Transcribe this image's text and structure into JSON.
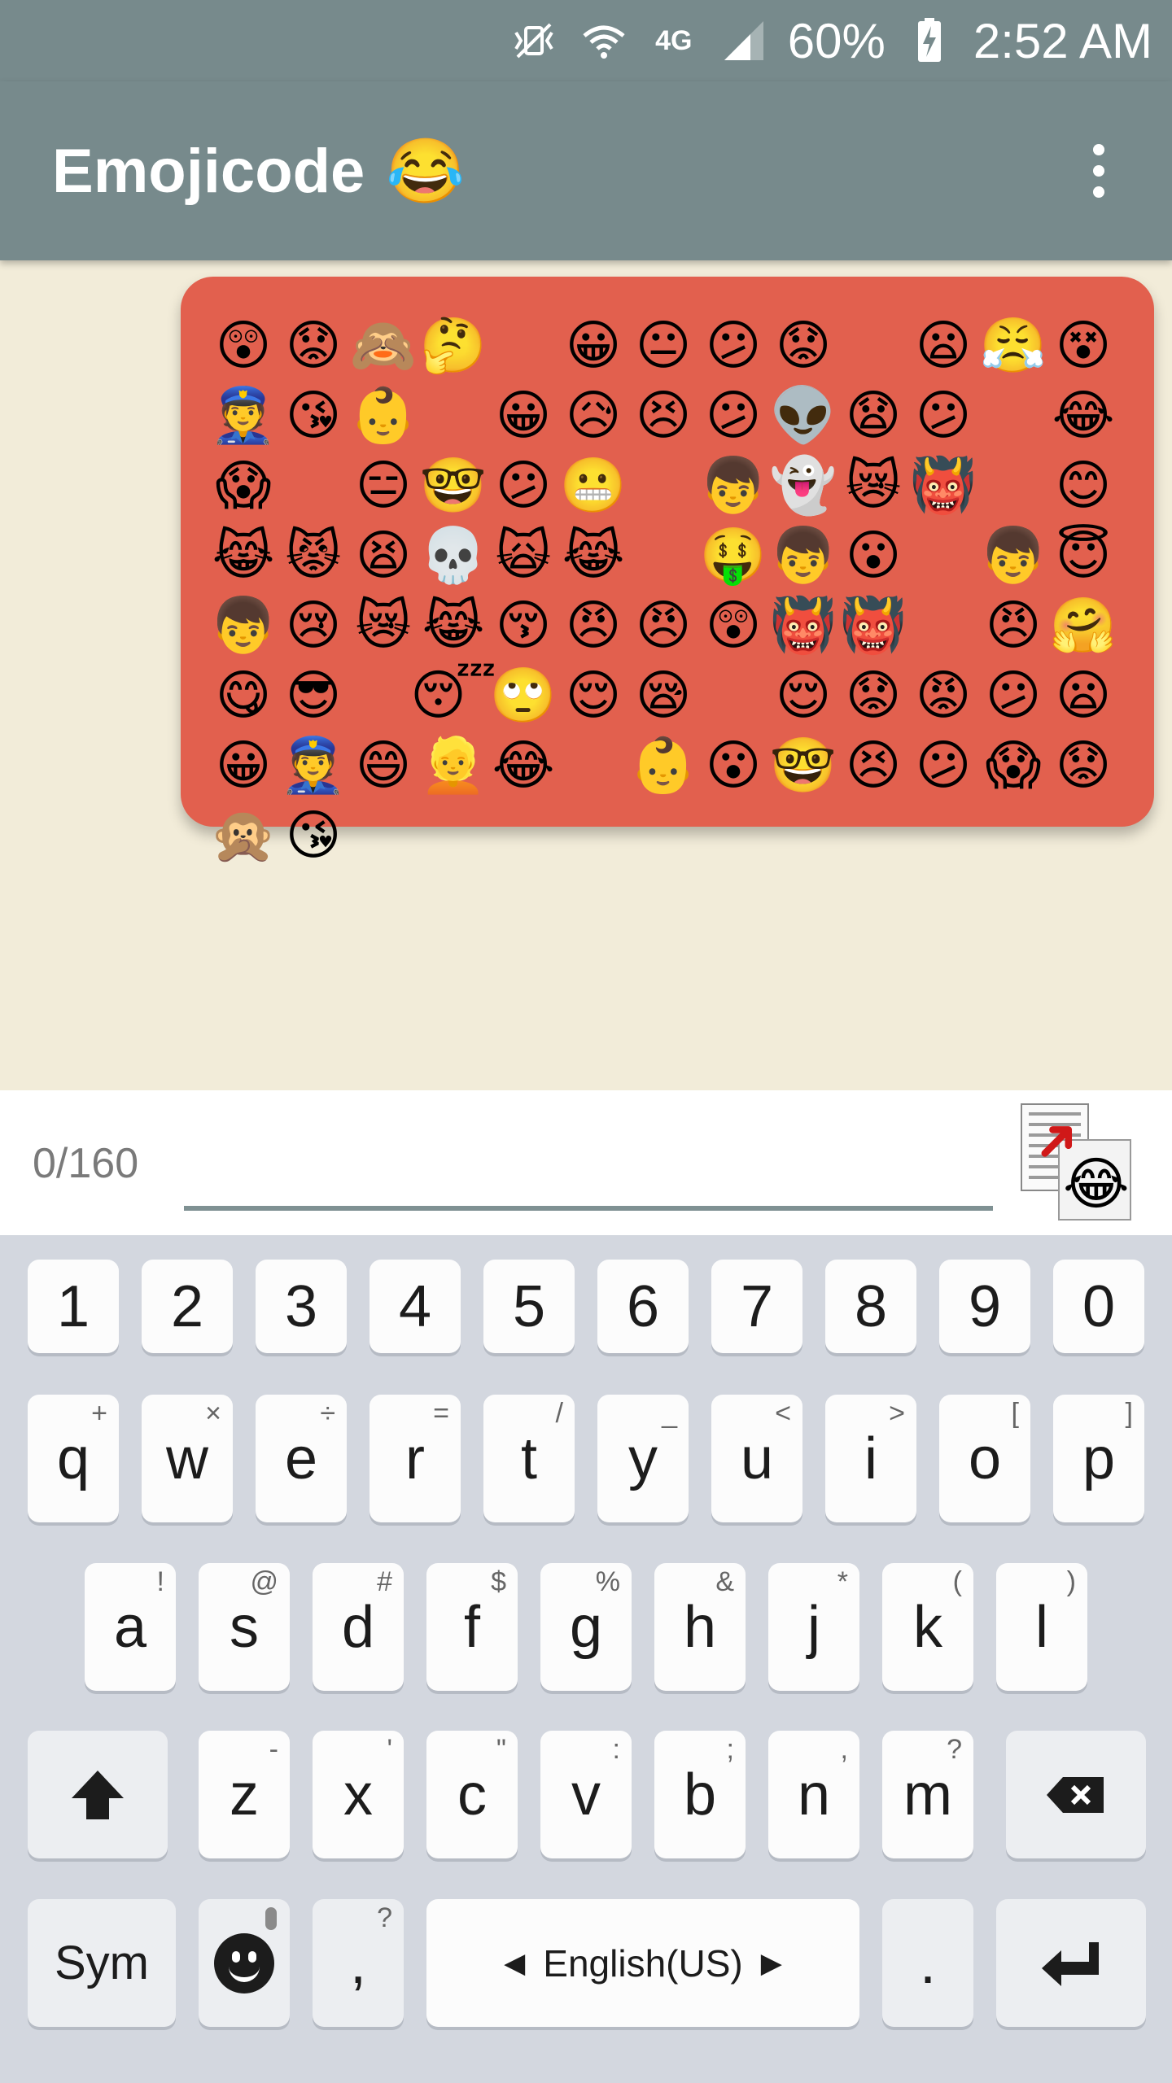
{
  "status": {
    "battery": "60%",
    "time": "2:52 AM",
    "network": "4G"
  },
  "appbar": {
    "title": "Emojicode",
    "title_emoji": "😂",
    "menu_icon": "overflow-menu-icon"
  },
  "message": {
    "bubble_color": "#e2604e",
    "emojis": [
      "😲",
      "😟",
      "🙈",
      "🤔",
      "",
      "😀",
      "😐",
      "😕",
      "😟",
      "",
      "😦",
      "😤",
      "😵",
      "👮",
      "😘",
      "👶",
      "",
      "😀",
      "😥",
      "😣",
      "😕",
      "👽",
      "😧",
      "😕",
      "",
      "😂",
      "😱",
      "",
      "😑",
      "🤓",
      "😕",
      "😬",
      "",
      "👦",
      "👻",
      "😿",
      "👹",
      "",
      "😊",
      "😹",
      "😾",
      "😫",
      "💀",
      "🙀",
      "😹",
      "",
      "🤑",
      "👦",
      "😮",
      "",
      "👦",
      "😇",
      "👦",
      "😢",
      "😿",
      "😹",
      "😚",
      "😠",
      "😠",
      "😲",
      "👹",
      "👹",
      "",
      "😠",
      "🤗",
      "😋",
      "😎",
      "",
      "😴",
      "🙄",
      "😌",
      "😪",
      "",
      "😌",
      "😟",
      "😡",
      "😕",
      "😦",
      "😀",
      "👮",
      "😄",
      "👱",
      "😂",
      "",
      "👶",
      "😮",
      "🤓",
      "😣",
      "😕",
      "😱",
      "😟",
      "🙊",
      "😘",
      "",
      "",
      "",
      "",
      ""
    ]
  },
  "compose": {
    "counter": "0/160",
    "value": "",
    "placeholder": "",
    "paste_emoji": "😂",
    "underline_color": "#7f9193"
  },
  "keyboard": {
    "number_row": [
      "1",
      "2",
      "3",
      "4",
      "5",
      "6",
      "7",
      "8",
      "9",
      "0"
    ],
    "row1": [
      {
        "k": "q",
        "h": "+"
      },
      {
        "k": "w",
        "h": "×"
      },
      {
        "k": "e",
        "h": "÷"
      },
      {
        "k": "r",
        "h": "="
      },
      {
        "k": "t",
        "h": "/"
      },
      {
        "k": "y",
        "h": "_"
      },
      {
        "k": "u",
        "h": "<"
      },
      {
        "k": "i",
        "h": ">"
      },
      {
        "k": "o",
        "h": "["
      },
      {
        "k": "p",
        "h": "]"
      }
    ],
    "row2": [
      {
        "k": "a",
        "h": "!"
      },
      {
        "k": "s",
        "h": "@"
      },
      {
        "k": "d",
        "h": "#"
      },
      {
        "k": "f",
        "h": "$"
      },
      {
        "k": "g",
        "h": "%"
      },
      {
        "k": "h",
        "h": "&"
      },
      {
        "k": "j",
        "h": "*"
      },
      {
        "k": "k",
        "h": "("
      },
      {
        "k": "l",
        "h": ")"
      }
    ],
    "row3": [
      {
        "k": "z",
        "h": "-"
      },
      {
        "k": "x",
        "h": "'"
      },
      {
        "k": "c",
        "h": "\""
      },
      {
        "k": "v",
        "h": ":"
      },
      {
        "k": "b",
        "h": ";"
      },
      {
        "k": "n",
        "h": ","
      },
      {
        "k": "m",
        "h": "?"
      }
    ],
    "sym": "Sym",
    "comma": ",",
    "comma_hint": "?",
    "space_label": "English(US)",
    "period": ".",
    "shift_icon": "shift-arrow-icon",
    "backspace_icon": "backspace-icon",
    "enter_icon": "enter-icon",
    "emoji_icon": "emoji-face-icon"
  }
}
